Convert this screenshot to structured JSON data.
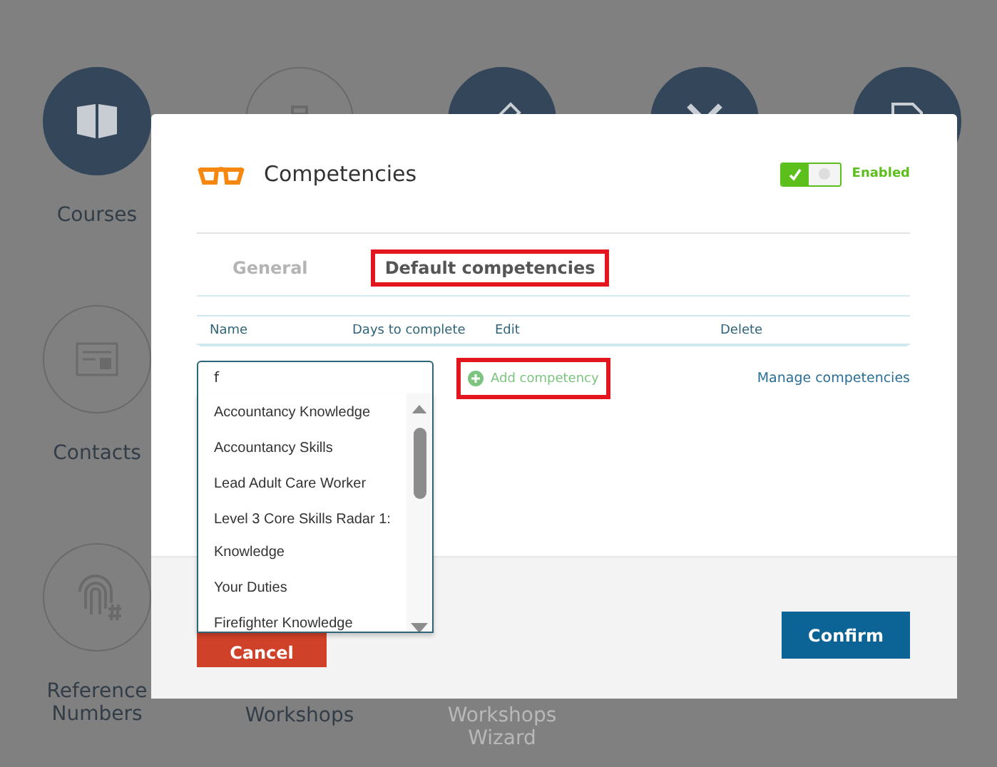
{
  "tiles": [
    {
      "kind": "filled",
      "label": "Courses",
      "disabled": false
    },
    {
      "kind": "outline"
    },
    {
      "kind": "filled"
    },
    {
      "kind": "filled"
    },
    {
      "kind": "filled"
    },
    {
      "kind": "outline",
      "label": "Contacts",
      "disabled": false
    },
    {
      "kind": "blank"
    },
    {
      "kind": "blank"
    },
    {
      "kind": "blank"
    },
    {
      "kind": "blank"
    },
    {
      "kind": "outline",
      "label": "Reference Numbers",
      "disabled": false
    },
    {
      "kind": "hidden",
      "label": "Workshops",
      "disabled": false
    },
    {
      "kind": "hidden",
      "label": "Workshops Wizard",
      "disabled": true
    }
  ],
  "dialog": {
    "title": "Competencies",
    "enabled": {
      "on": true,
      "label": "Enabled"
    },
    "tabs": [
      {
        "label": "General",
        "selected": false,
        "highlighted": false
      },
      {
        "label": "Default competencies",
        "selected": true,
        "highlighted": true
      }
    ],
    "table": {
      "columns": [
        "Name",
        "Days to complete",
        "Edit",
        "Delete"
      ]
    },
    "search": {
      "value": "f"
    },
    "add_button": {
      "label": "Add competency",
      "highlighted": true
    },
    "manage_link": "Manage competencies",
    "suggestions": [
      "Accountancy Knowledge",
      "Accountancy Skills",
      "Lead Adult Care Worker",
      "Level 3 Core Skills Radar 1: Knowledge",
      "Your Duties",
      "Firefighter Knowledge"
    ],
    "buttons": {
      "cancel": "Cancel",
      "confirm": "Confirm"
    }
  }
}
